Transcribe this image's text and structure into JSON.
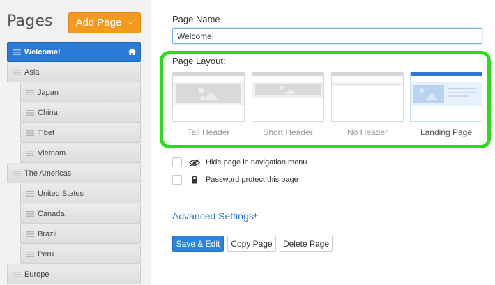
{
  "sidebar": {
    "title": "Pages",
    "add_button_label": "Add Page",
    "pages": [
      {
        "label": "Welcome!",
        "level": 0,
        "selected": true,
        "home": true
      },
      {
        "label": "Asia",
        "level": 0
      },
      {
        "label": "Japan",
        "level": 1
      },
      {
        "label": "China",
        "level": 1
      },
      {
        "label": "Tibet",
        "level": 1
      },
      {
        "label": "Vietnam",
        "level": 1
      },
      {
        "label": "The Americas",
        "level": 0
      },
      {
        "label": "United States",
        "level": 1
      },
      {
        "label": "Canada",
        "level": 1
      },
      {
        "label": "Brazil",
        "level": 1
      },
      {
        "label": "Peru",
        "level": 1
      },
      {
        "label": "Europe",
        "level": 0
      }
    ]
  },
  "main": {
    "page_name_label": "Page Name",
    "page_name_value": "Welcome!",
    "layout_label": "Page Layout:",
    "layouts": [
      {
        "name": "Tall Header",
        "selected": false
      },
      {
        "name": "Short Header",
        "selected": false
      },
      {
        "name": "No Header",
        "selected": false
      },
      {
        "name": "Landing Page",
        "selected": true
      }
    ],
    "options": [
      {
        "label": "Hide page in navigation menu",
        "icon": "eye-icon",
        "checked": false
      },
      {
        "label": "Password protect this page",
        "icon": "lock-icon",
        "checked": false
      }
    ],
    "advanced_settings_label": "Advanced Settings",
    "advanced_settings_plus": "+",
    "buttons": {
      "save_edit": "Save & Edit",
      "copy": "Copy Page",
      "delete": "Delete Page"
    }
  },
  "colors": {
    "accent": "#2a7ad6",
    "add_button": "#f39a1f",
    "highlight": "#2bdc18"
  }
}
